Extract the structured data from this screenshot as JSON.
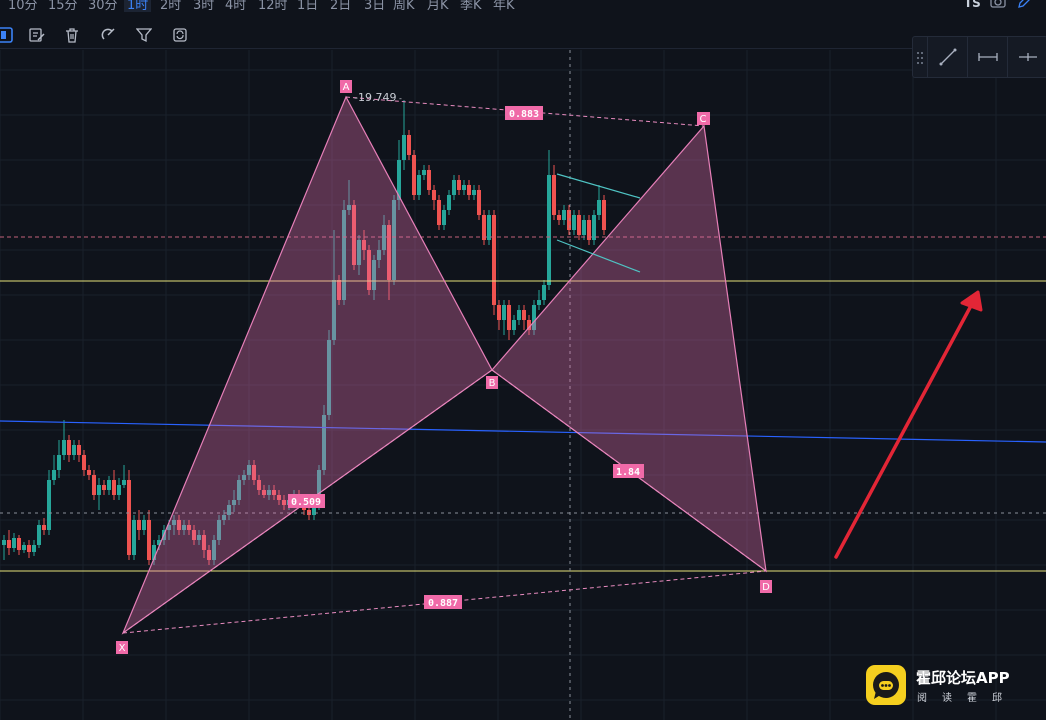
{
  "timeframes": [
    {
      "label": "10分",
      "active": false
    },
    {
      "label": "15分",
      "active": false
    },
    {
      "label": "30分",
      "active": false
    },
    {
      "label": "1时",
      "active": true
    },
    {
      "label": "2时",
      "active": false
    },
    {
      "label": "3时",
      "active": false
    },
    {
      "label": "4时",
      "active": false
    },
    {
      "label": "12时",
      "active": false
    },
    {
      "label": "1日",
      "active": false
    },
    {
      "label": "2日",
      "active": false
    },
    {
      "label": "3日",
      "active": false
    },
    {
      "label": "周K",
      "active": false
    },
    {
      "label": "月K",
      "active": false
    },
    {
      "label": "季K",
      "active": false
    },
    {
      "label": "年K",
      "active": false
    }
  ],
  "top_right": {
    "ts_label": "TS"
  },
  "pattern": {
    "points": {
      "X": "X",
      "A": "A",
      "B": "B",
      "C": "C",
      "D": "D"
    },
    "ratios": {
      "xb": "0.509",
      "ac": "0.883",
      "bd": "1.84",
      "xd": "0.887"
    },
    "a_price_label": "-19.749"
  },
  "colors": {
    "pattern_fill": "#e66fb0",
    "pattern_label_bg": "#f06aa8",
    "candle_up": "#26a69a",
    "candle_down": "#ef5350",
    "arrow": "#e32636",
    "yellow_line": "#e6e27a",
    "blue_line": "#2962ff",
    "channel": "#4fc3c3"
  },
  "watermark": {
    "title": "霍邱论坛APP",
    "subtitle": "阅读霍邱"
  }
}
